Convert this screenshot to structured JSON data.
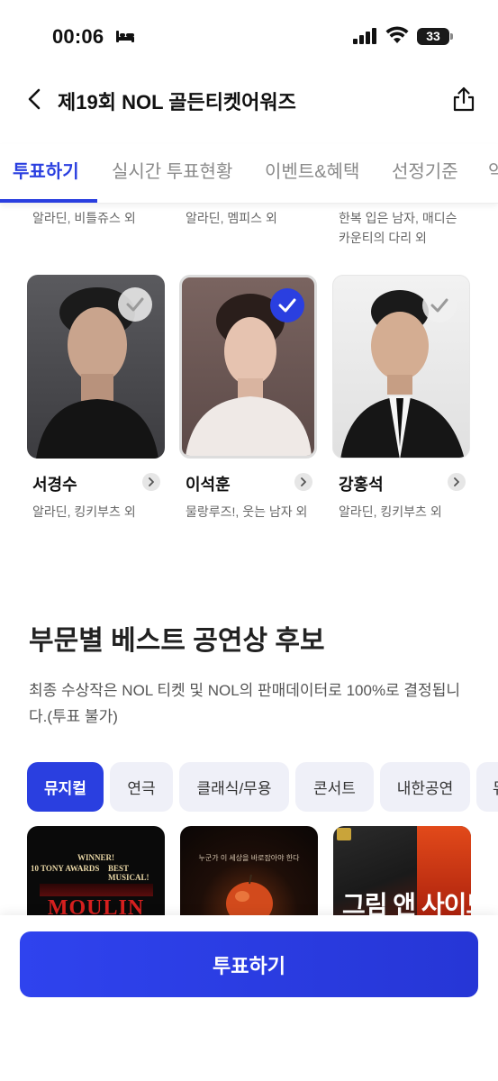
{
  "status_bar": {
    "time": "00:06",
    "battery": "33"
  },
  "header": {
    "title": "제19회 NOL 골든티켓어워즈"
  },
  "tabs": [
    {
      "label": "투표하기",
      "active": true
    },
    {
      "label": "실시간 투표현황",
      "active": false
    },
    {
      "label": "이벤트&혜택",
      "active": false
    },
    {
      "label": "선정기준",
      "active": false
    },
    {
      "label": "약",
      "active": false
    }
  ],
  "partial_row": [
    {
      "desc": "알라딘, 비틀쥬스 외"
    },
    {
      "desc": "알라딘, 멤피스 외"
    },
    {
      "desc_line1": "한복 입은 남자, 매디슨",
      "desc_line2": "카운티의 다리 외"
    }
  ],
  "candidates": [
    {
      "name": "서경수",
      "desc": "알라딘, 킹키부츠 외",
      "selected": false
    },
    {
      "name": "이석훈",
      "desc": "물랑루즈!, 웃는 남자 외",
      "selected": true
    },
    {
      "name": "강홍석",
      "desc": "알라딘, 킹키부츠 외",
      "selected": false
    }
  ],
  "section": {
    "title": "부문별 베스트 공연상 후보",
    "desc": "최종 수상작은 NOL 티켓 및 NOL의 판매데이터로 100%로 결정됩니다.(투표 불가)"
  },
  "categories": [
    {
      "label": "뮤지컬",
      "active": true
    },
    {
      "label": "연극",
      "active": false
    },
    {
      "label": "클래식/무용",
      "active": false
    },
    {
      "label": "콘서트",
      "active": false
    },
    {
      "label": "내한공연",
      "active": false
    },
    {
      "label": "뮤",
      "active": false
    }
  ],
  "posters": [
    {
      "line1": "WINNER!",
      "line2": "10 TONY AWARDS",
      "line3": "BEST MUSICAL!",
      "title": "MOULIN"
    },
    {
      "line1": "누군가 이 세상을 바로잡아야 한다"
    },
    {
      "title": "그림 앤 사이드"
    }
  ],
  "bottom": {
    "vote_label": "투표하기"
  },
  "colors": {
    "accent": "#2a3fe0",
    "chip_bg": "#eff0f8",
    "muted_text": "#666666"
  }
}
